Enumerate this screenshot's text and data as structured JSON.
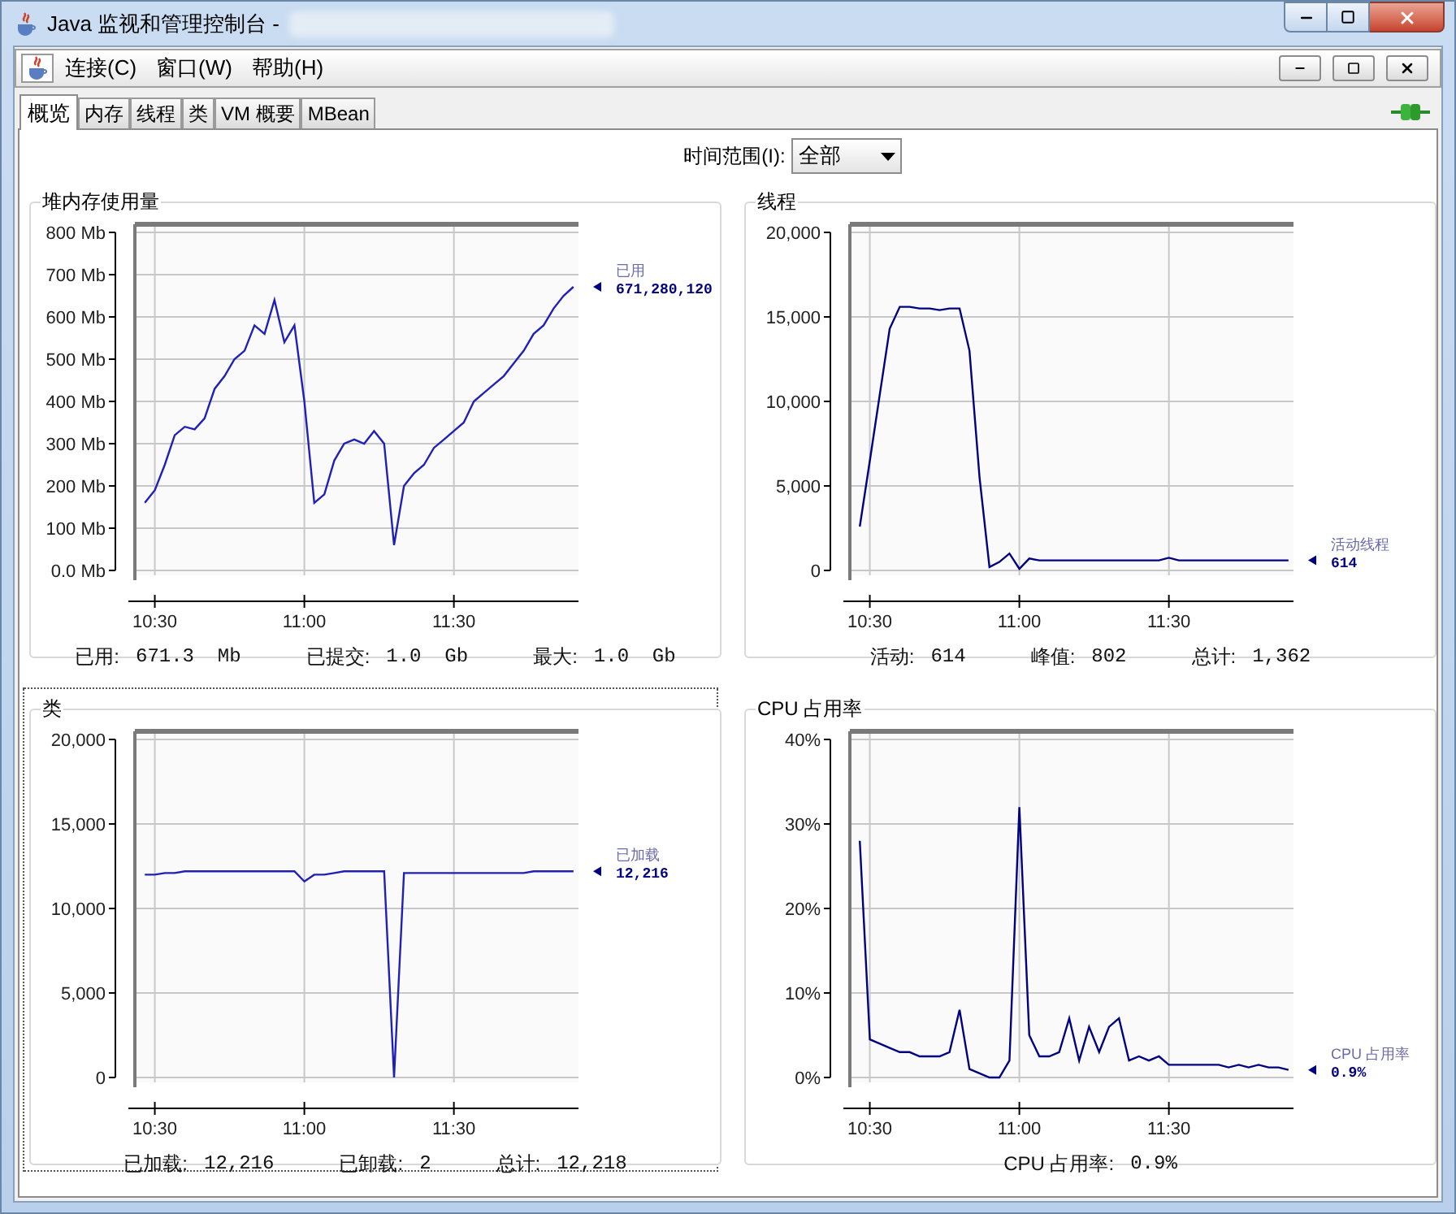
{
  "window": {
    "title": "Java 监视和管理控制台 -"
  },
  "menu": [
    {
      "label": "连接(C)"
    },
    {
      "label": "窗口(W)"
    },
    {
      "label": "帮助(H)"
    }
  ],
  "tabs": [
    {
      "label": "概览",
      "selected": true
    },
    {
      "label": "内存",
      "selected": false
    },
    {
      "label": "线程",
      "selected": false
    },
    {
      "label": "类",
      "selected": false
    },
    {
      "label": "VM 概要",
      "selected": false
    },
    {
      "label": "MBean",
      "selected": false
    }
  ],
  "time_range": {
    "label": "时间范围(I):",
    "value": "全部"
  },
  "panels": [
    {
      "title": "堆内存使用量",
      "focused": false,
      "legend_value": "671,280,120",
      "stats": [
        {
          "label": "已用:",
          "value": "671.3  Mb"
        },
        {
          "label": "已提交:",
          "value": "1.0  Gb"
        },
        {
          "label": "最大:",
          "value": "1.0  Gb"
        }
      ],
      "chart_data": {
        "type": "line",
        "categories": [
          null,
          "10:30",
          null,
          null,
          null,
          null,
          null,
          null,
          null,
          null,
          null,
          null,
          null,
          null,
          null,
          null,
          "11:00",
          null,
          null,
          null,
          null,
          null,
          null,
          null,
          null,
          null,
          null,
          null,
          null,
          null,
          null,
          "11:30",
          null,
          null,
          null,
          null,
          null,
          null,
          null,
          null,
          null,
          null,
          null,
          null
        ],
        "series": [
          {
            "name": "已用",
            "color": "#2020b8",
            "values": [
              160,
              190,
              250,
              320,
              340,
              334,
              360,
              430,
              460,
              500,
              520,
              580,
              560,
              640,
              540,
              580,
              400,
              160,
              180,
              260,
              300,
              310,
              300,
              330,
              300,
              60,
              200,
              230,
              250,
              290,
              310,
              330,
              350,
              400,
              420,
              440,
              460,
              490,
              520,
              560,
              580,
              620,
              650,
              671
            ]
          }
        ],
        "grid": true,
        "ylim": [
          0,
          800
        ],
        "yticks": [
          {
            "value": 0,
            "label": "0.0 Mb"
          },
          {
            "value": 100,
            "label": "100 Mb"
          },
          {
            "value": 200,
            "label": "200 Mb"
          },
          {
            "value": 300,
            "label": "300 Mb"
          },
          {
            "value": 400,
            "label": "400 Mb"
          },
          {
            "value": 500,
            "label": "500 Mb"
          },
          {
            "value": 600,
            "label": "600 Mb"
          },
          {
            "value": 700,
            "label": "700 Mb"
          },
          {
            "value": 800,
            "label": "800 Mb"
          }
        ]
      }
    },
    {
      "title": "线程",
      "focused": false,
      "legend_value": "614",
      "stats": [
        {
          "label": "活动:",
          "value": "614"
        },
        {
          "label": "峰值:",
          "value": "802"
        },
        {
          "label": "总计:",
          "value": "1,362"
        }
      ],
      "chart_data": {
        "type": "line",
        "categories": [
          null,
          "10:30",
          null,
          null,
          null,
          null,
          null,
          null,
          null,
          null,
          null,
          null,
          null,
          null,
          null,
          null,
          "11:00",
          null,
          null,
          null,
          null,
          null,
          null,
          null,
          null,
          null,
          null,
          null,
          null,
          null,
          null,
          "11:30",
          null,
          null,
          null,
          null,
          null,
          null,
          null,
          null,
          null,
          null,
          null,
          null
        ],
        "series": [
          {
            "name": "活动线程",
            "color": "#000080",
            "values": [
              2600,
              6500,
              10400,
              14300,
              15600,
              15600,
              15500,
              15500,
              15400,
              15500,
              15500,
              13000,
              5500,
              200,
              500,
              1000,
              100,
              700,
              600,
              600,
              600,
              600,
              600,
              600,
              600,
              600,
              600,
              600,
              600,
              600,
              600,
              750,
              600,
              600,
              600,
              600,
              600,
              600,
              600,
              600,
              600,
              600,
              600,
              600
            ]
          }
        ],
        "grid": true,
        "ylim": [
          0,
          20000
        ],
        "yticks": [
          {
            "value": 0,
            "label": "0"
          },
          {
            "value": 5000,
            "label": "5,000"
          },
          {
            "value": 10000,
            "label": "10,000"
          },
          {
            "value": 15000,
            "label": "15,000"
          },
          {
            "value": 20000,
            "label": "20,000"
          }
        ]
      }
    },
    {
      "title": "类",
      "focused": true,
      "legend_value": "12,216",
      "stats": [
        {
          "label": "已加载:",
          "value": "12,216"
        },
        {
          "label": "已卸载:",
          "value": "2"
        },
        {
          "label": "总计:",
          "value": "12,218"
        }
      ],
      "chart_data": {
        "type": "line",
        "categories": [
          null,
          "10:30",
          null,
          null,
          null,
          null,
          null,
          null,
          null,
          null,
          null,
          null,
          null,
          null,
          null,
          null,
          "11:00",
          null,
          null,
          null,
          null,
          null,
          null,
          null,
          null,
          null,
          null,
          null,
          null,
          null,
          null,
          "11:30",
          null,
          null,
          null,
          null,
          null,
          null,
          null,
          null,
          null,
          null,
          null,
          null
        ],
        "series": [
          {
            "name": "已加载",
            "color": "#2020b8",
            "values": [
              12000,
              12000,
              12100,
              12100,
              12200,
              12200,
              12200,
              12200,
              12200,
              12200,
              12200,
              12200,
              12200,
              12200,
              12200,
              12200,
              11600,
              12000,
              12000,
              12100,
              12200,
              12200,
              12200,
              12200,
              12200,
              0,
              12100,
              12100,
              12100,
              12100,
              12100,
              12100,
              12100,
              12100,
              12100,
              12100,
              12100,
              12100,
              12100,
              12200,
              12200,
              12200,
              12200,
              12200
            ]
          }
        ],
        "grid": true,
        "ylim": [
          0,
          20000
        ],
        "yticks": [
          {
            "value": 0,
            "label": "0"
          },
          {
            "value": 5000,
            "label": "5,000"
          },
          {
            "value": 10000,
            "label": "10,000"
          },
          {
            "value": 15000,
            "label": "15,000"
          },
          {
            "value": 20000,
            "label": "20,000"
          }
        ]
      }
    },
    {
      "title": "CPU 占用率",
      "focused": false,
      "legend_value": "0.9%",
      "stats": [
        {
          "label": "CPU 占用率:",
          "value": "0.9%"
        }
      ],
      "chart_data": {
        "type": "line",
        "categories": [
          null,
          "10:30",
          null,
          null,
          null,
          null,
          null,
          null,
          null,
          null,
          null,
          null,
          null,
          null,
          null,
          null,
          "11:00",
          null,
          null,
          null,
          null,
          null,
          null,
          null,
          null,
          null,
          null,
          null,
          null,
          null,
          null,
          "11:30",
          null,
          null,
          null,
          null,
          null,
          null,
          null,
          null,
          null,
          null,
          null,
          null
        ],
        "series": [
          {
            "name": "CPU 占用率",
            "color": "#000080",
            "values": [
              28,
              4.5,
              4,
              3.5,
              3,
              3,
              2.5,
              2.5,
              2.5,
              3,
              8,
              1,
              0.5,
              0,
              0,
              2,
              32,
              5,
              2.5,
              2.5,
              3,
              7,
              2,
              6,
              3,
              6,
              7,
              2,
              2.5,
              2,
              2.5,
              1.5,
              1.5,
              1.5,
              1.5,
              1.5,
              1.5,
              1.2,
              1.5,
              1.2,
              1.5,
              1.2,
              1.2,
              0.9
            ]
          }
        ],
        "grid": true,
        "ylim": [
          0,
          40
        ],
        "yticks": [
          {
            "value": 0,
            "label": "0%"
          },
          {
            "value": 10,
            "label": "10%"
          },
          {
            "value": 20,
            "label": "20%"
          },
          {
            "value": 30,
            "label": "30%"
          },
          {
            "value": 40,
            "label": "40%"
          }
        ]
      }
    }
  ]
}
